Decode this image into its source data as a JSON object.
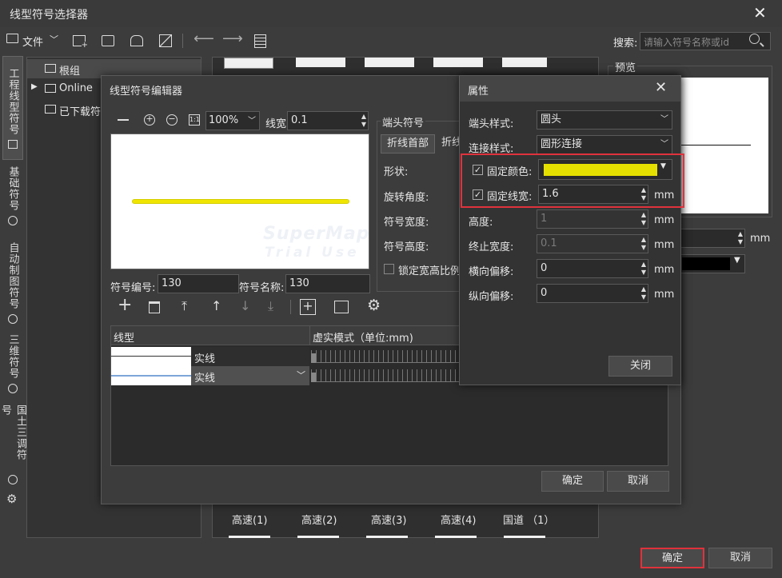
{
  "title": "线型符号选择器",
  "toolbar": {
    "file": "文件",
    "search_label": "搜索:",
    "search_placeholder": "请输入符号名称或id"
  },
  "side_tabs": [
    "工程线型符号",
    "基础符号",
    "自动制图符号",
    "三维符号",
    "国土三调符号"
  ],
  "tree": [
    "根组",
    "Online",
    "已下载符"
  ],
  "preview_label": "预览",
  "right_unit": "mm",
  "bottom_labels": [
    "高速(1)",
    "高速(2)",
    "高速(3)",
    "高速(4)",
    "国道 （1）"
  ],
  "main_ok": "确定",
  "main_cancel": "取消",
  "editor": {
    "title": "线型符号编辑器",
    "zoom": "100%",
    "line_width_label": "线宽:",
    "line_width": "0.1",
    "end_group": "端头符号",
    "end_tabs": [
      "折线首部",
      "折线"
    ],
    "end_fields": [
      "形状:",
      "旋转角度:",
      "符号宽度:",
      "符号高度:"
    ],
    "lock_ratio": "锁定宽高比例",
    "code_label": "符号编号:",
    "code": "130",
    "name_label": "符号名称:",
    "name": "130",
    "col_line": "线型",
    "col_mode": "虚实模式（单位:mm)",
    "rows": [
      "实线",
      "实线"
    ],
    "ok": "确定",
    "cancel": "取消",
    "watermark1": "SuperMap",
    "watermark2": "Trial Use",
    "line_color": "#e6e000"
  },
  "props": {
    "title": "属性",
    "cap_label": "端头样式:",
    "cap": "圆头",
    "join_label": "连接样式:",
    "join": "圆形连接",
    "fixed_color_label": "固定颜色:",
    "fixed_color": "#e6e000",
    "fixed_width_label": "固定线宽:",
    "fixed_width": "1.6",
    "height_label": "高度:",
    "height": "1",
    "end_width_label": "终止宽度:",
    "end_width": "0.1",
    "h_offset_label": "横向偏移:",
    "h_offset": "0",
    "v_offset_label": "纵向偏移:",
    "v_offset": "0",
    "unit": "mm",
    "close": "关闭"
  },
  "highlight_color": "#e0323c"
}
